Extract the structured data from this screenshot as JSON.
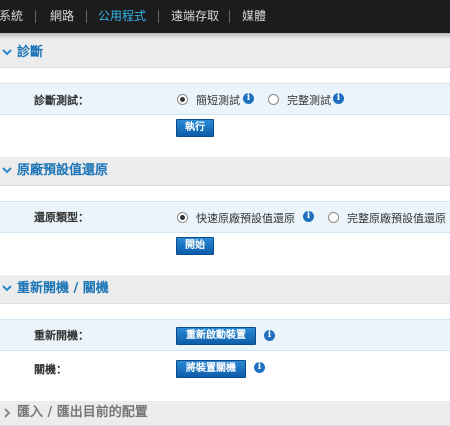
{
  "nav": {
    "items": [
      {
        "label": "系統",
        "active": false
      },
      {
        "label": "網路",
        "active": false
      },
      {
        "label": "公用程式",
        "active": true
      },
      {
        "label": "遠端存取",
        "active": false
      },
      {
        "label": "媒體",
        "active": false
      }
    ]
  },
  "diagnostics": {
    "title": "診斷",
    "label": "診斷測試：",
    "options": [
      {
        "label": "簡短測試",
        "selected": true
      },
      {
        "label": "完整測試",
        "selected": false
      }
    ],
    "run_button": "執行"
  },
  "factory_restore": {
    "title": "原廠預設值還原",
    "label": "還原類型：",
    "options": [
      {
        "label": "快速原廠預設值還原",
        "selected": true
      },
      {
        "label": "完整原廠預設值還原",
        "selected": false
      }
    ],
    "start_button": "開始"
  },
  "reboot": {
    "title": "重新開機 / 關機",
    "reboot_label": "重新開機：",
    "reboot_button": "重新啟動裝置",
    "shutdown_label": "關機：",
    "shutdown_button": "將裝置關機"
  },
  "import_export": {
    "title": "匯入 / 匯出目前的配置"
  },
  "colors": {
    "accent": "#35b4ec",
    "section_title": "#1a74b6",
    "button": "#0d5da9",
    "info_icon": "#1f6fbf"
  }
}
